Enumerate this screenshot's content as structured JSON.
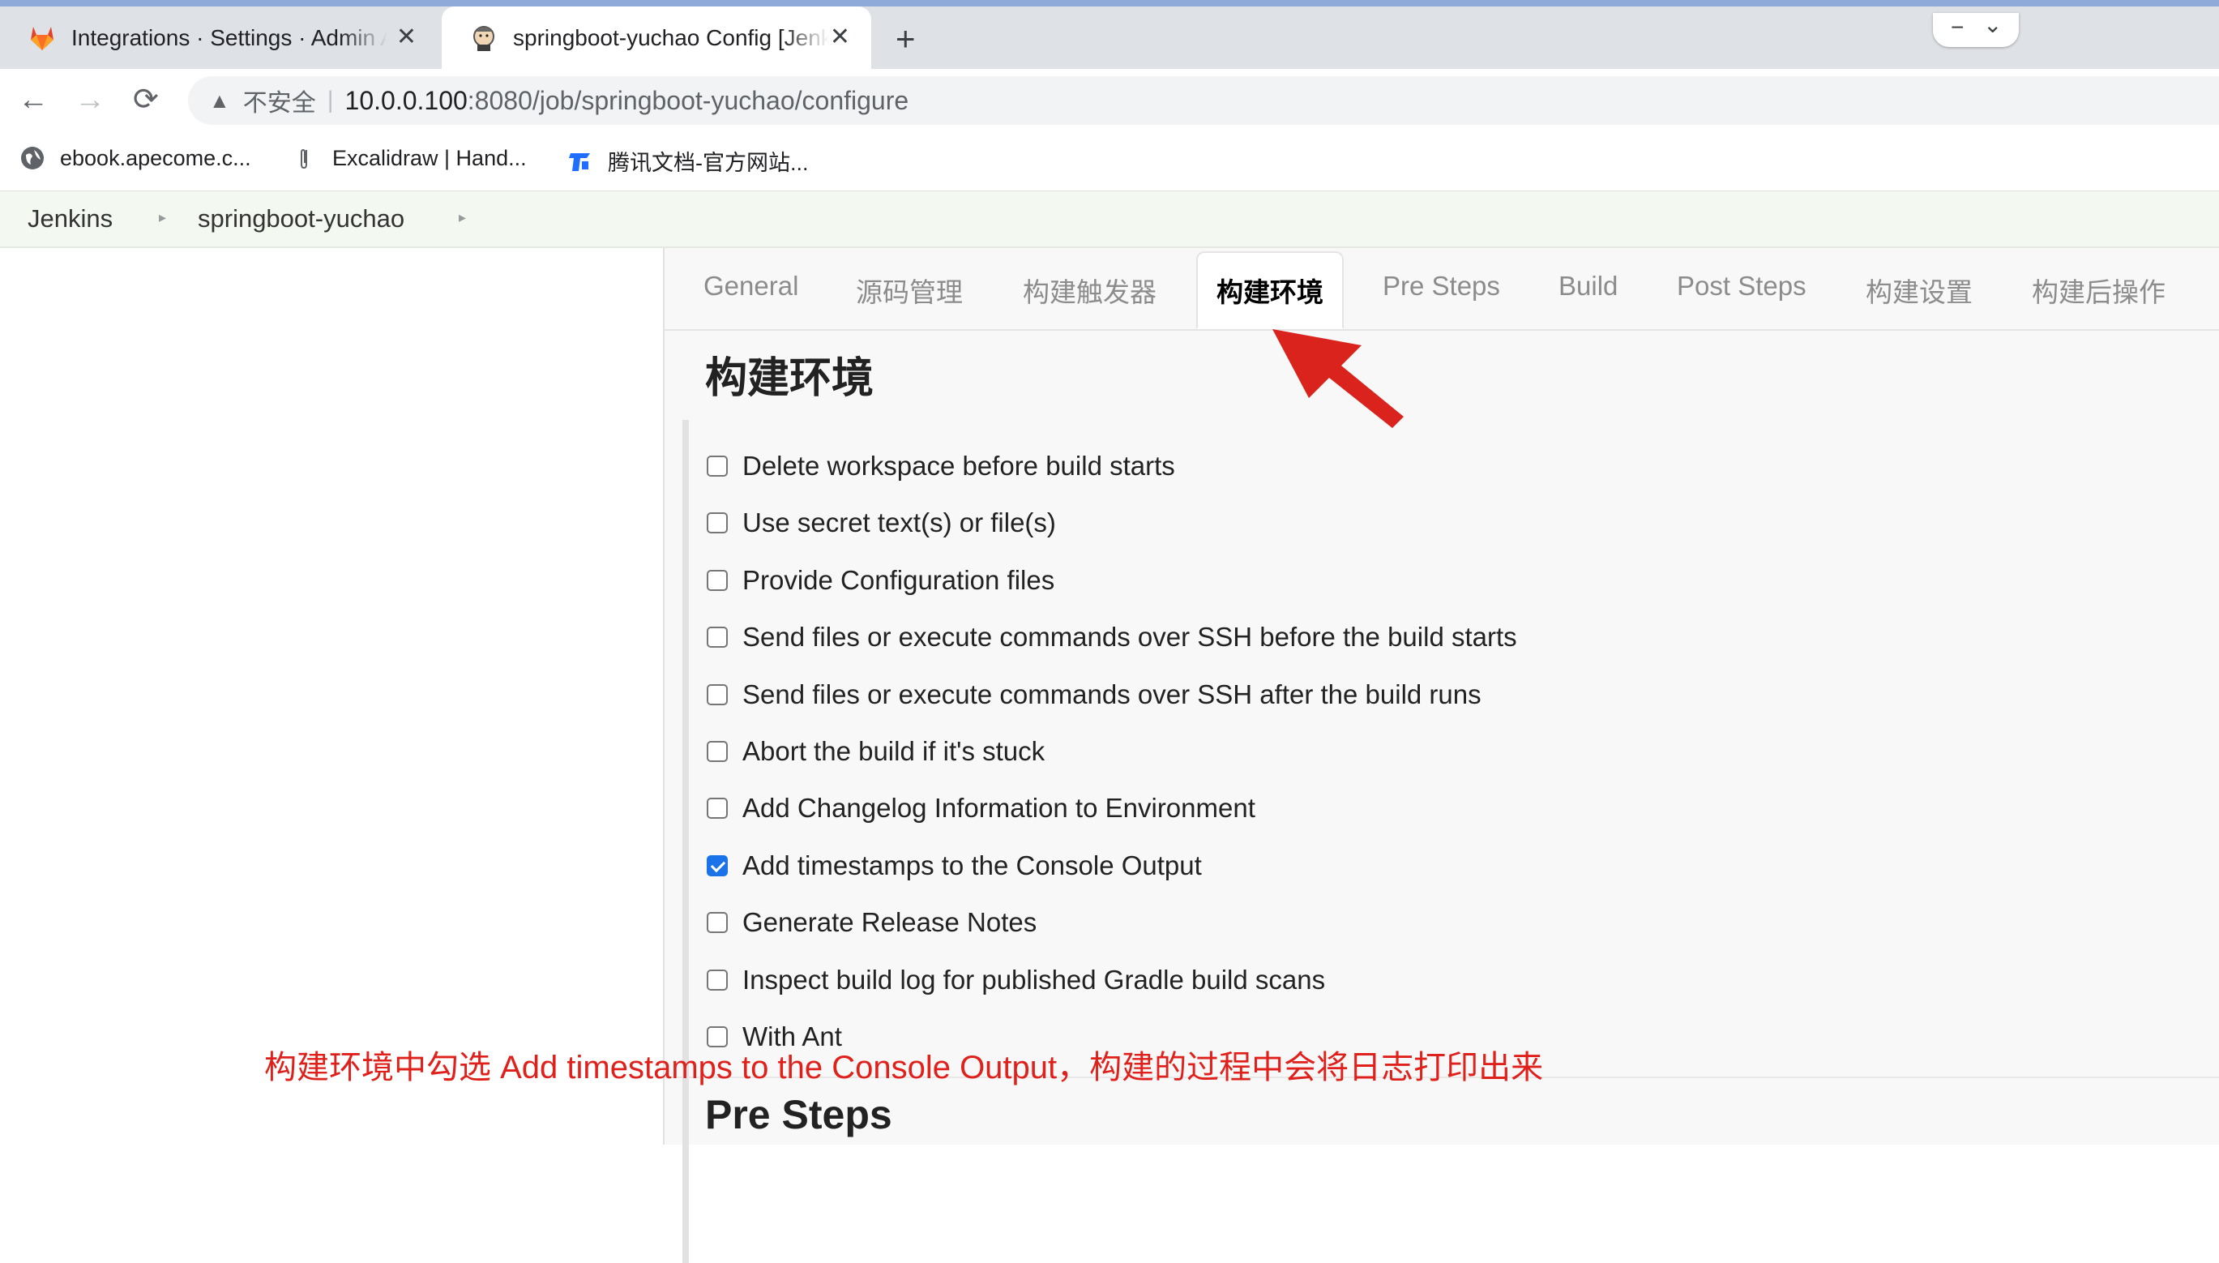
{
  "browser": {
    "tabs": [
      {
        "title": "Integrations · Settings · Admin Area · GitLab",
        "favicon": "gitlab-icon"
      },
      {
        "title": "springboot-yuchao Config [Jenkins]",
        "favicon": "jenkins-icon",
        "active": true
      }
    ],
    "new_tab": "+",
    "close": "✕",
    "window_controls": {
      "minimize": "−",
      "expand": "⌄"
    },
    "nav": {
      "back": "←",
      "forward": "→",
      "reload": "⟳"
    },
    "address": {
      "warning_icon": "▲",
      "security_label": "不安全",
      "separator": "|",
      "host": "10.0.0.100",
      "rest": ":8080/job/springboot-yuchao/configure"
    },
    "bookmarks": [
      {
        "label": "ebook.apecome.c...",
        "icon": "globe-icon"
      },
      {
        "label": "Excalidraw | Hand...",
        "icon": "paperclip-icon"
      },
      {
        "label": "腾讯文档-官方网站...",
        "icon": "tencent-docs-icon"
      }
    ]
  },
  "breadcrumb": {
    "items": [
      "Jenkins",
      "springboot-yuchao"
    ],
    "separator": "▸"
  },
  "config_tabs": [
    "General",
    "源码管理",
    "构建触发器",
    "构建环境",
    "Pre Steps",
    "Build",
    "Post Steps",
    "构建设置",
    "构建后操作"
  ],
  "active_tab": "构建环境",
  "section": {
    "title": "构建环境",
    "options": [
      {
        "label": "Delete workspace before build starts",
        "checked": false
      },
      {
        "label": "Use secret text(s) or file(s)",
        "checked": false
      },
      {
        "label": "Provide Configuration files",
        "checked": false
      },
      {
        "label": "Send files or execute commands over SSH before the build starts",
        "checked": false
      },
      {
        "label": "Send files or execute commands over SSH after the build runs",
        "checked": false
      },
      {
        "label": "Abort the build if it's stuck",
        "checked": false
      },
      {
        "label": "Add Changelog Information to Environment",
        "checked": false
      },
      {
        "label": "Add timestamps to the Console Output",
        "checked": true
      },
      {
        "label": "Generate Release Notes",
        "checked": false
      },
      {
        "label": "Inspect build log for published Gradle build scans",
        "checked": false
      },
      {
        "label": "With Ant",
        "checked": false
      }
    ]
  },
  "next_section": {
    "title": "Pre Steps"
  },
  "annotation": {
    "text": "构建环境中勾选 Add timestamps to the Console Output，构建的过程中会将日志打印出来",
    "color": "#e0201b"
  },
  "colors": {
    "accent": "#1a73e8",
    "arrow": "#d9231c"
  }
}
